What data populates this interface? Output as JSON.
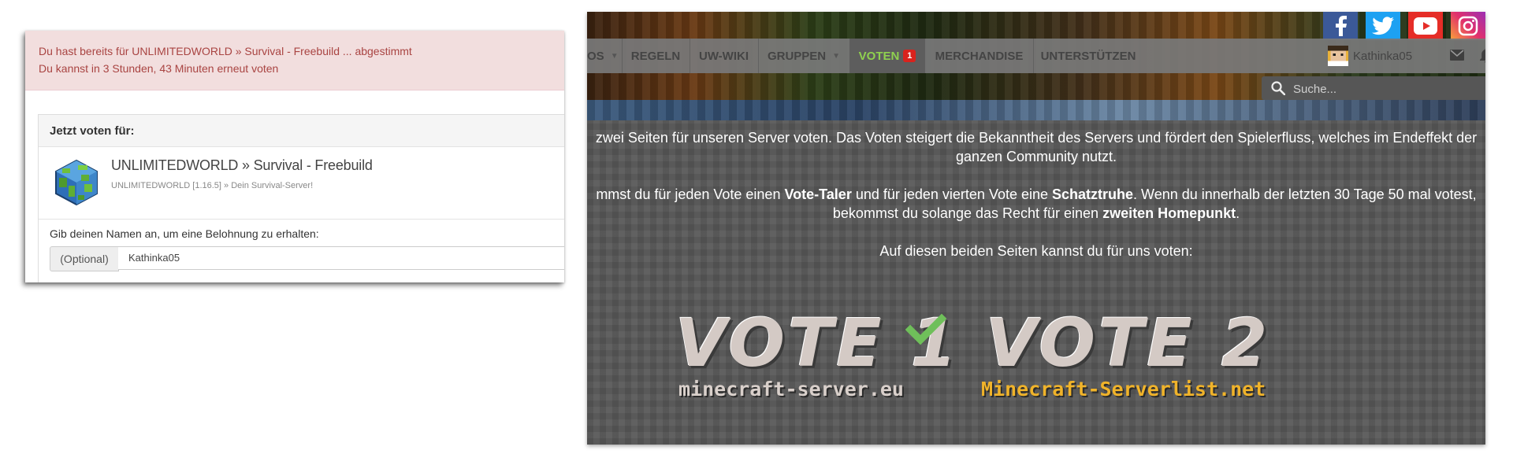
{
  "alert": {
    "line1": "Du hast bereits für UNLIMITEDWORLD » Survival - Freebuild ... abgestimmt",
    "line2": "Du kannst in 3 Stunden, 43 Minuten erneut voten"
  },
  "vote_panel": {
    "heading": "Jetzt voten für:",
    "server_title": "UNLIMITEDWORLD » Survival - Freebuild",
    "server_subtitle": "UNLIMITEDWORLD [1.16.5] » Dein Survival-Server!",
    "name_label": "Gib deinen Namen an, um eine Belohnung zu erhalten:",
    "addon": "(Optional)",
    "name_value": "Kathinka05"
  },
  "nav": {
    "items": [
      {
        "label": "OS"
      },
      {
        "label": "REGELN"
      },
      {
        "label": "UW-WIKI"
      },
      {
        "label": "GRUPPEN"
      },
      {
        "label": "VOTEN",
        "badge": "1"
      },
      {
        "label": "MERCHANDISE"
      },
      {
        "label": "UNTERSTÜTZEN"
      }
    ],
    "username": "Kathinka05",
    "active_color": "#8fd14f"
  },
  "search": {
    "placeholder": "Suche..."
  },
  "content": {
    "p1a": "zwei Seiten für unseren Server voten. Das Voten steigert die Bekanntheit des Servers und fördert den Spielerfluss, welches im Endeffekt der",
    "p1b": "ganzen Community nutzt.",
    "p2a_1": "mmst du für jeden Vote einen ",
    "p2a_b1": "Vote-Taler",
    "p2a_2": " und für jeden vierten Vote eine ",
    "p2a_b2": "Schatztruhe",
    "p2a_3": ". Wenn du innerhalb der letzten 30 Tage 50 mal votest,",
    "p2b_1": "bekommst du solange das Recht für einen ",
    "p2b_b": "zweiten Homepunkt",
    "p2b_2": ".",
    "p3": "Auf diesen beiden Seiten kannst du für uns voten:"
  },
  "vote_buttons": [
    {
      "title": "VOTE 1",
      "site": "minecraft-server.eu",
      "site_color": "#d9d0cb",
      "voted": true
    },
    {
      "title": "VOTE 2",
      "site": "Minecraft-Serverlist.net",
      "site_color": "#f0b32a",
      "voted": false
    }
  ],
  "social": [
    "facebook-icon",
    "twitter-icon",
    "youtube-icon",
    "instagram-icon"
  ]
}
